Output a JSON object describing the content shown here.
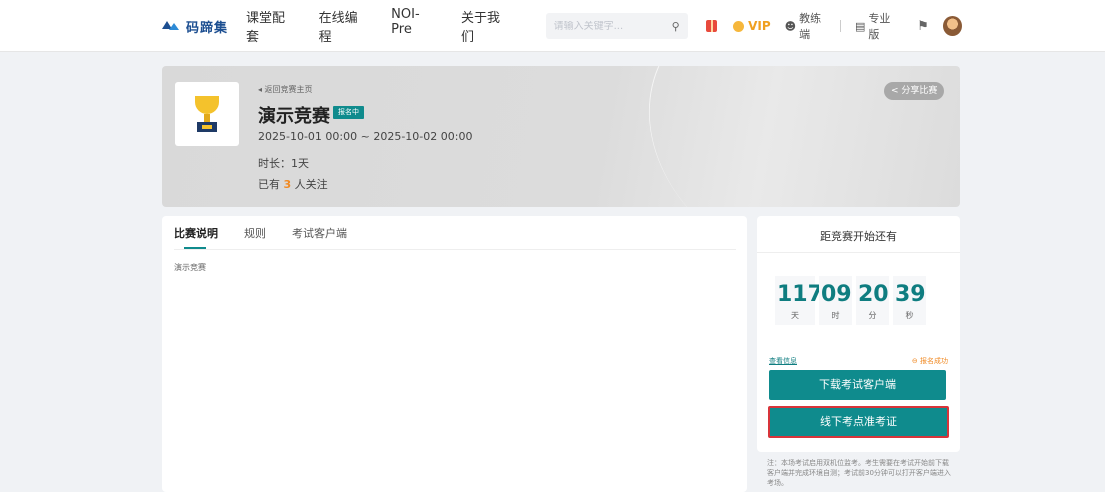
{
  "header": {
    "logo_text": "码蹄集",
    "nav": [
      "课堂配套",
      "在线编程",
      "NOI-Pre",
      "关于我们"
    ],
    "search_placeholder": "请输入关键字...",
    "vip_label": "VIP",
    "coach_label": "教练端",
    "pro_label": "专业版"
  },
  "banner": {
    "back_label": "◂ 返回竞赛主页",
    "title": "演示竞赛",
    "status_badge": "报名中",
    "date_range": "2025-10-01 00:00 ~ 2025-10-02 00:00",
    "duration": "时长：1天",
    "followers_prefix": "已有",
    "followers_count": "3",
    "followers_suffix": "人关注",
    "share_label": "分享比赛"
  },
  "tabs": [
    "比赛说明",
    "规则",
    "考试客户端"
  ],
  "description": "演示竞赛",
  "countdown": {
    "title": "距竞赛开始还有",
    "days": "117",
    "days_label": "天",
    "hours": "09",
    "hours_label": "时",
    "minutes": "20",
    "minutes_label": "分",
    "seconds": "39",
    "seconds_label": "秒"
  },
  "actions": {
    "view_info": "查看信息",
    "registered": "报名成功",
    "download_client": "下载考试客户端",
    "offline_ticket": "线下考点准考证"
  },
  "note": "注：本场考试启用双机位监考。考生需要在考试开始前下载客户端并完成环境自测；考试前30分钟可以打开客户端进入考场。",
  "colors": {
    "accent": "#0f8b8d",
    "highlight_border": "#d8343a",
    "orange": "#f08a24"
  }
}
